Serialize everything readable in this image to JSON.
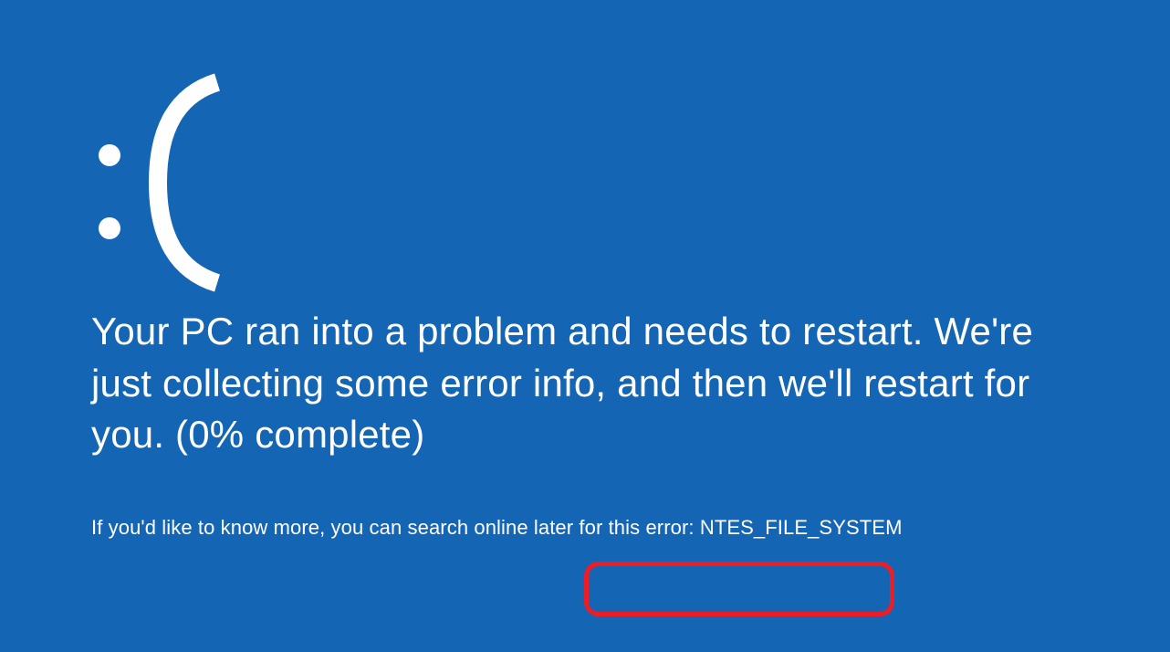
{
  "bsod": {
    "main_message": "Your PC ran into a problem and needs to restart. We're just collecting some error info, and then we'll restart for you. (0% complete)",
    "footer_prefix": "If you'd like to know more, you can search online later for this error: ",
    "error_code": "NTES_FILE_SYSTEM"
  }
}
